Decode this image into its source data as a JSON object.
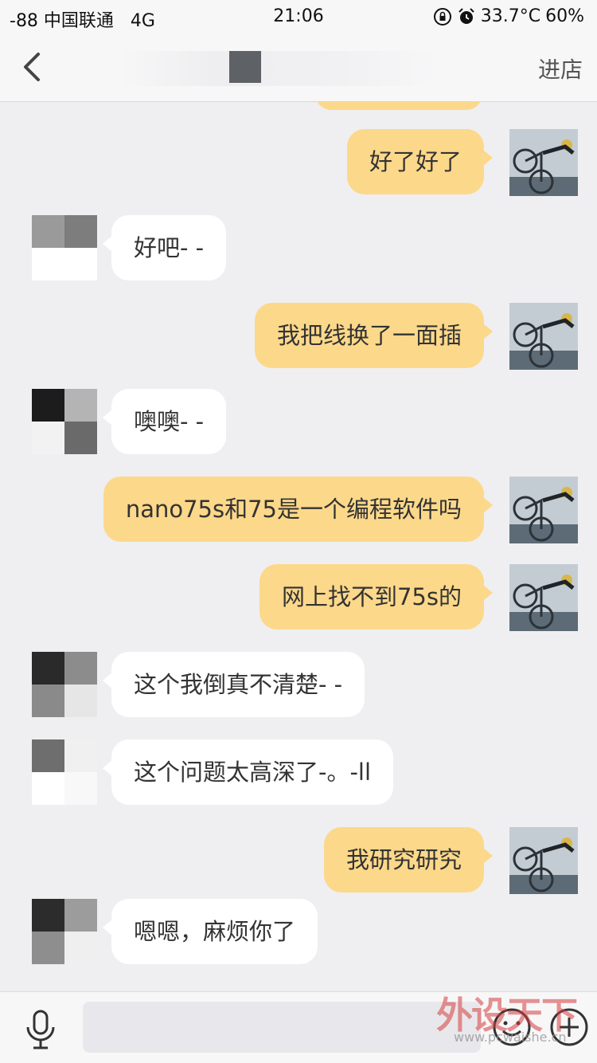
{
  "status_bar": {
    "carrier": "-88 中国联通",
    "network": "4G",
    "time": "21:06",
    "temperature": "33.7°C",
    "battery": "60%"
  },
  "nav": {
    "store_label": "进店"
  },
  "messages": [
    {
      "side": "right",
      "text": "好了好了"
    },
    {
      "side": "left",
      "text": "好吧- -"
    },
    {
      "side": "right",
      "text": "我把线换了一面插"
    },
    {
      "side": "left",
      "text": "噢噢- -"
    },
    {
      "side": "right",
      "text": "nano75s和75是一个编程软件吗"
    },
    {
      "side": "right",
      "text": "网上找不到75s的"
    },
    {
      "side": "left",
      "text": "这个我倒真不清楚- -"
    },
    {
      "side": "left",
      "text": "这个问题太高深了-。-ll"
    },
    {
      "side": "right",
      "text": "我研究研究"
    },
    {
      "side": "left",
      "text": "嗯嗯，麻烦你了"
    }
  ],
  "input_bar": {
    "placeholder": ""
  },
  "watermark": {
    "text": "外设天下",
    "url": "www.pcwaishe.cn"
  },
  "colors": {
    "self_bubble": "#fcd88a",
    "other_bubble": "#ffffff",
    "background": "#efeff2"
  }
}
